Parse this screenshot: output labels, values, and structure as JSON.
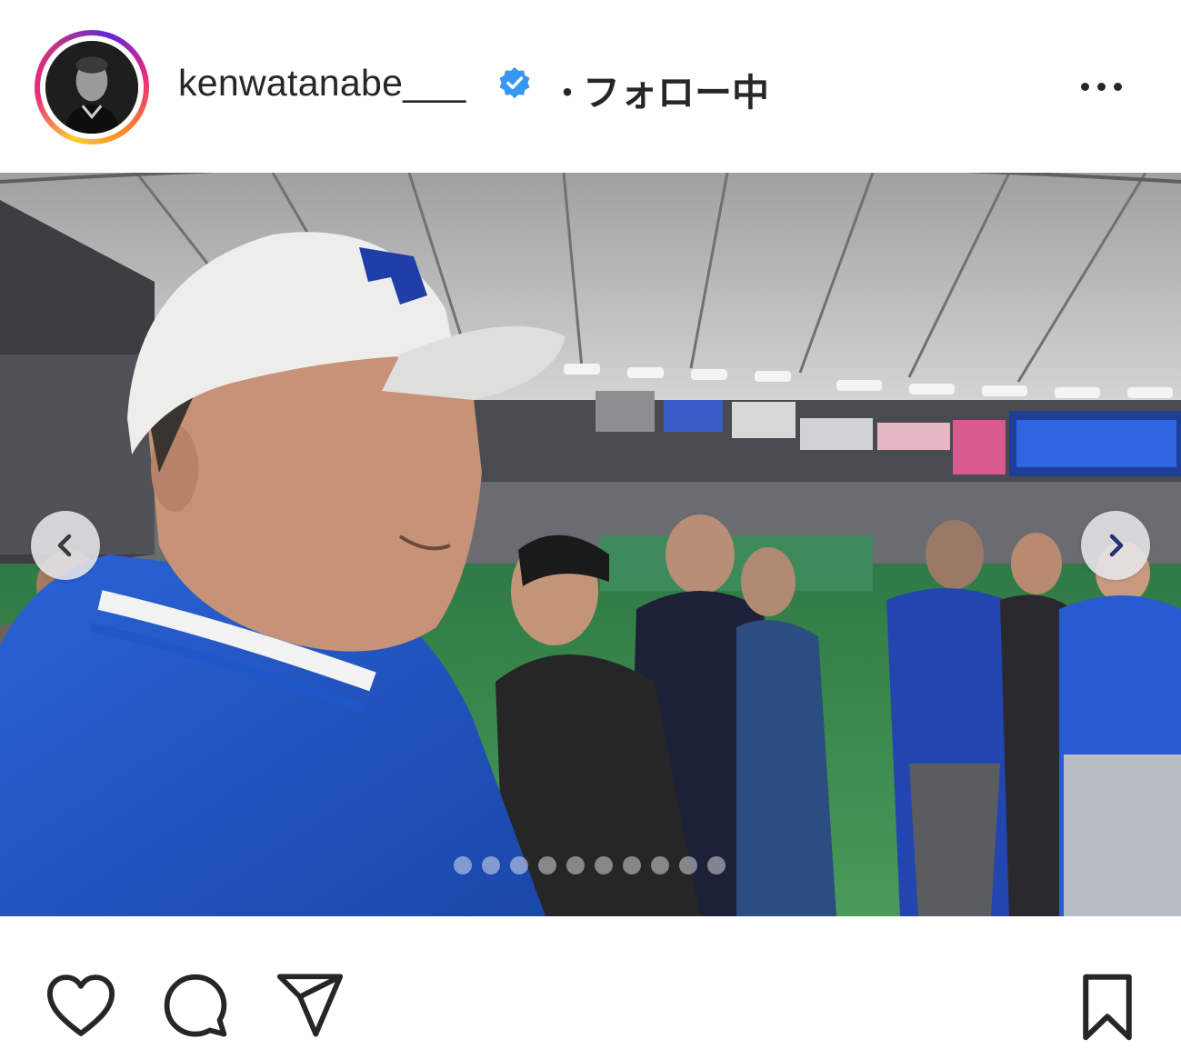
{
  "header": {
    "username": "kenwatanabe___",
    "separator": "・",
    "follow_status": "フォロー中",
    "verified_icon": "verified-badge-icon",
    "more_icon": "more-options-icon"
  },
  "photo": {
    "carousel_total": 10,
    "carousel_active_index": 5,
    "prev_icon": "chevron-left-icon",
    "next_icon": "chevron-right-icon"
  },
  "actions": {
    "like_icon": "heart-icon",
    "comment_icon": "comment-icon",
    "share_icon": "send-icon",
    "save_icon": "bookmark-icon"
  },
  "colors": {
    "verified_blue": "#3897f0",
    "text": "#262626",
    "jacket_blue": "#1f56c8",
    "field_green": "#3a8a4e"
  }
}
